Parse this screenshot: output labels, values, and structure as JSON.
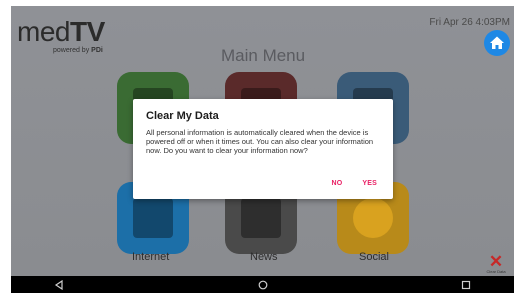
{
  "logo": {
    "word_light": "med",
    "word_bold": "TV",
    "tagline_prefix": "powered by",
    "tagline_brand": "PDi"
  },
  "status": {
    "datetime": "Fri Apr 26  4:03PM"
  },
  "menu": {
    "title": "Main Menu",
    "tile_labels": {
      "internet": "Internet",
      "news": "News",
      "social": "Social"
    }
  },
  "dialog": {
    "title": "Clear My Data",
    "body": "All personal information is automatically cleared when the device is powered off or when it times out. You can also clear your information now. Do you want to clear your information now?",
    "no_label": "NO",
    "yes_label": "YES",
    "accent_color": "#e91e63"
  },
  "clear_data": {
    "icon": "close-icon",
    "label": "Clear Data"
  },
  "icons": {
    "home": "home-icon",
    "back": "back-triangle-icon",
    "home_nav": "home-circle-icon",
    "recents": "recents-square-icon"
  },
  "colors": {
    "home_button": "#1e88e5",
    "clear_x": "#c62828"
  }
}
